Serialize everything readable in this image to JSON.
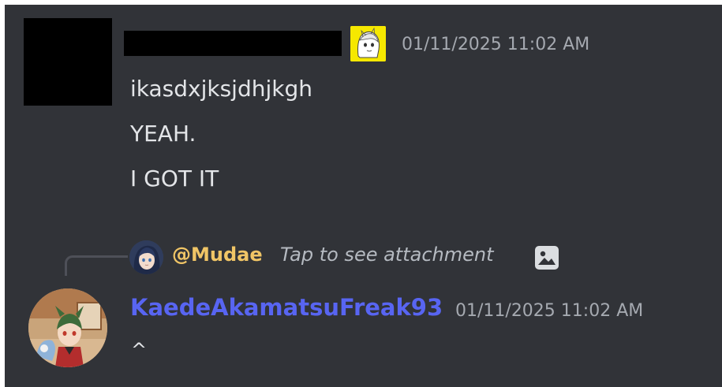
{
  "message1": {
    "timestamp": "01/11/2025 11:02 AM",
    "lines": [
      "ikasdxjksjdhjkgh",
      "YEAH.",
      "I GOT IT"
    ],
    "badge_icon": "anime-character-badge-icon"
  },
  "reply": {
    "mention": "@Mudae",
    "text": "Tap to see attachment",
    "icon": "image-icon"
  },
  "message2": {
    "username": "KaedeAkamatsuFreak93",
    "timestamp": "01/11/2025 11:02 AM",
    "text": "^"
  },
  "colors": {
    "background": "#313338",
    "username": "#5865f2",
    "mention": "#f0c566",
    "timestamp": "#a5a9b0",
    "badge": "#f6e800"
  }
}
